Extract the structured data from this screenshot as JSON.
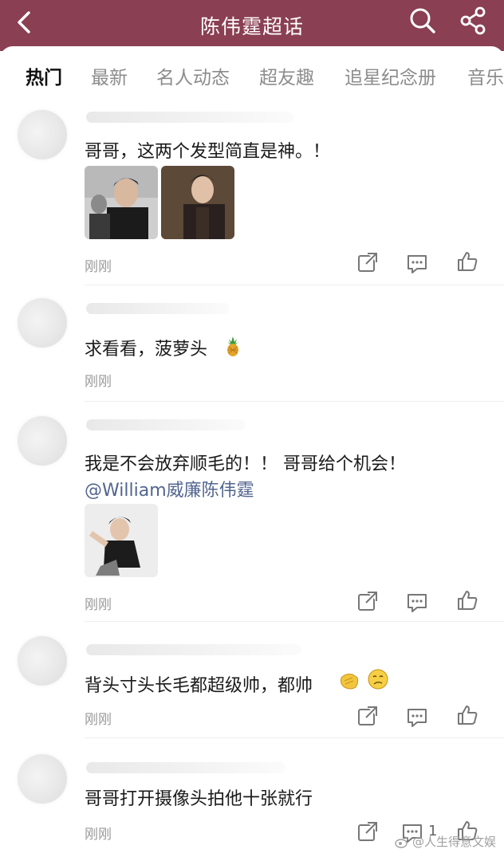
{
  "header": {
    "title": "陈伟霆超话"
  },
  "tabs": [
    "热门",
    "最新",
    "名人动态",
    "超友趣",
    "追星纪念册",
    "音乐"
  ],
  "posts": [
    {
      "text": "哥哥，这两个发型简直是神。！",
      "time": "刚刚"
    },
    {
      "text": "求看看，菠萝头",
      "time": "刚刚"
    },
    {
      "text": "我是不会放弃顺毛的！！ 哥哥给个机会！",
      "mention": "@William威廉陈伟霆",
      "time": "刚刚"
    },
    {
      "text": "背头寸头长毛都超级帅，都帅",
      "time": "刚刚"
    },
    {
      "text": "哥哥打开摄像头拍他十张就行",
      "time": "刚刚",
      "comment_count": "1"
    }
  ],
  "watermark": "@人生得意文娱",
  "colors": {
    "header_bg": "#8a3f52",
    "mention": "#52658f"
  }
}
